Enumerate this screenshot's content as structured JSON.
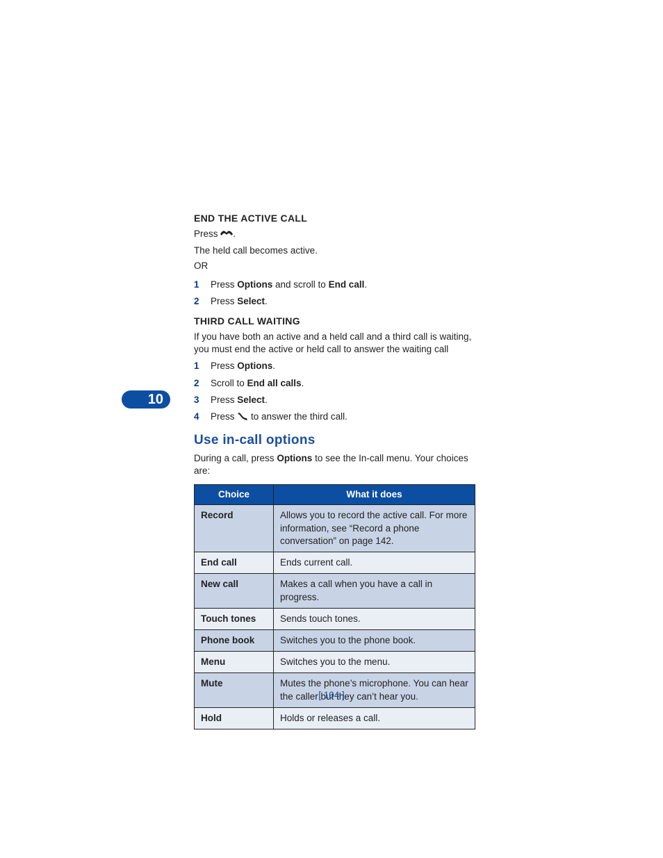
{
  "chapter_number": "10",
  "section1": {
    "heading": "END THE ACTIVE CALL",
    "press_prefix": "Press ",
    "press_suffix": ".",
    "line_active": "The held call becomes active.",
    "or": "OR",
    "steps": [
      {
        "num": "1",
        "pre": "Press ",
        "bold1": "Options",
        "mid": " and scroll to ",
        "bold2": "End call",
        "post": "."
      },
      {
        "num": "2",
        "pre": "Press ",
        "bold1": "Select",
        "post": "."
      }
    ]
  },
  "section2": {
    "heading": "THIRD CALL WAITING",
    "intro": "If you have both an active and a held call and a third call is waiting, you must end the active or held call to answer the waiting call",
    "steps": [
      {
        "num": "1",
        "pre": "Press ",
        "bold1": "Options",
        "post": "."
      },
      {
        "num": "2",
        "pre": "Scroll to ",
        "bold1": "End all calls",
        "post": "."
      },
      {
        "num": "3",
        "pre": "Press ",
        "bold1": "Select",
        "post": "."
      },
      {
        "num": "4",
        "pre": "Press ",
        "icon": true,
        "post": " to answer the third call."
      }
    ]
  },
  "section3": {
    "title": "Use in-call options",
    "intro_pre": "During a call, press ",
    "intro_bold": "Options",
    "intro_post": " to see the In-call menu. Your choices are:"
  },
  "table": {
    "headers": {
      "choice": "Choice",
      "desc": "What it does"
    },
    "rows": [
      {
        "choice": "Record",
        "desc": "Allows you to record the active call. For more information, see “Record a phone conversation” on page 142."
      },
      {
        "choice": "End call",
        "desc": "Ends current call."
      },
      {
        "choice": "New call",
        "desc": "Makes a call when you have a call in progress."
      },
      {
        "choice": "Touch tones",
        "desc": "Sends touch tones."
      },
      {
        "choice": "Phone book",
        "desc": "Switches you to the phone book."
      },
      {
        "choice": "Menu",
        "desc": "Switches you to the menu."
      },
      {
        "choice": "Mute",
        "desc": "Mutes the phone’s microphone. You can hear the caller but they can’t hear you."
      },
      {
        "choice": "Hold",
        "desc": "Holds or releases a call."
      }
    ]
  },
  "page_number": "[ 104 ]"
}
